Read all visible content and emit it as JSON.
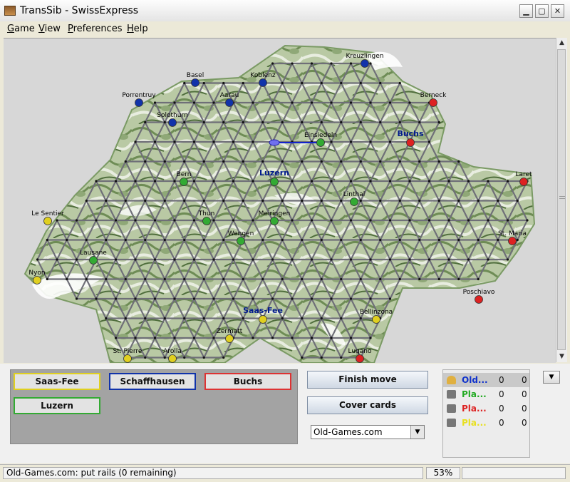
{
  "window": {
    "title": "TransSib - SwissExpress",
    "min_label": "▁",
    "max_label": "▢",
    "close_label": "✕"
  },
  "menu": [
    "Game",
    "View",
    "Preferences",
    "Help"
  ],
  "map": {
    "cities": [
      {
        "name": "Basel",
        "color": "#1133aa"
      },
      {
        "name": "Koblenz",
        "color": "#1133aa"
      },
      {
        "name": "Kreuzlingen",
        "color": "#1133aa"
      },
      {
        "name": "Porrentruy",
        "color": "#1133aa"
      },
      {
        "name": "Aarau",
        "color": "#1133aa"
      },
      {
        "name": "Solothurn",
        "color": "#1133aa"
      },
      {
        "name": "Berneck",
        "color": "#dd2222"
      },
      {
        "name": "Buchs",
        "color": "#dd2222"
      },
      {
        "name": "Einsiedeln",
        "color": "#33aa33"
      },
      {
        "name": "Luzern",
        "color": "#33aa33"
      },
      {
        "name": "Bern",
        "color": "#33aa33"
      },
      {
        "name": "Laret",
        "color": "#dd2222"
      },
      {
        "name": "Linthal",
        "color": "#33aa33"
      },
      {
        "name": "Le Sentier",
        "color": "#e0d020"
      },
      {
        "name": "Thun",
        "color": "#33aa33"
      },
      {
        "name": "Meiringen",
        "color": "#33aa33"
      },
      {
        "name": "Wengen",
        "color": "#33aa33"
      },
      {
        "name": "St. Maria",
        "color": "#dd2222"
      },
      {
        "name": "Lausane",
        "color": "#33aa33"
      },
      {
        "name": "Nyon",
        "color": "#e0d020"
      },
      {
        "name": "Poschiavo",
        "color": "#dd2222"
      },
      {
        "name": "Saas-Fee",
        "color": "#e0d020"
      },
      {
        "name": "Bellinzona",
        "color": "#e0d020"
      },
      {
        "name": "Zermatt",
        "color": "#e0d020"
      },
      {
        "name": "St. Pierre",
        "color": "#e0d020"
      },
      {
        "name": "Arolla",
        "color": "#e0d020"
      },
      {
        "name": "Lugano",
        "color": "#dd2222"
      }
    ]
  },
  "target_cards": [
    {
      "label": "Saas-Fee",
      "border": "#e0d020"
    },
    {
      "label": "Schaffhausen",
      "border": "#1133aa"
    },
    {
      "label": "Buchs",
      "border": "#dd3333"
    },
    {
      "label": "Luzern",
      "border": "#33aa33"
    }
  ],
  "actions": {
    "finish_move": "Finish move",
    "cover_cards": "Cover cards"
  },
  "player_select": {
    "value": "Old-Games.com",
    "arrow": "▼"
  },
  "players": [
    {
      "name": "Old...",
      "color": "#1133cc",
      "a": "0",
      "b": "0",
      "active": true
    },
    {
      "name": "Pla...",
      "color": "#22aa22",
      "a": "0",
      "b": "0",
      "active": false
    },
    {
      "name": "Pla...",
      "color": "#dd2222",
      "a": "0",
      "b": "0",
      "active": false
    },
    {
      "name": "Pla...",
      "color": "#e8e020",
      "a": "0",
      "b": "0",
      "active": false
    }
  ],
  "status": {
    "text": "Old-Games.com: put rails (0 remaining)",
    "zoom": "53%"
  },
  "scroll": {
    "up": "▲",
    "down": "▼"
  }
}
